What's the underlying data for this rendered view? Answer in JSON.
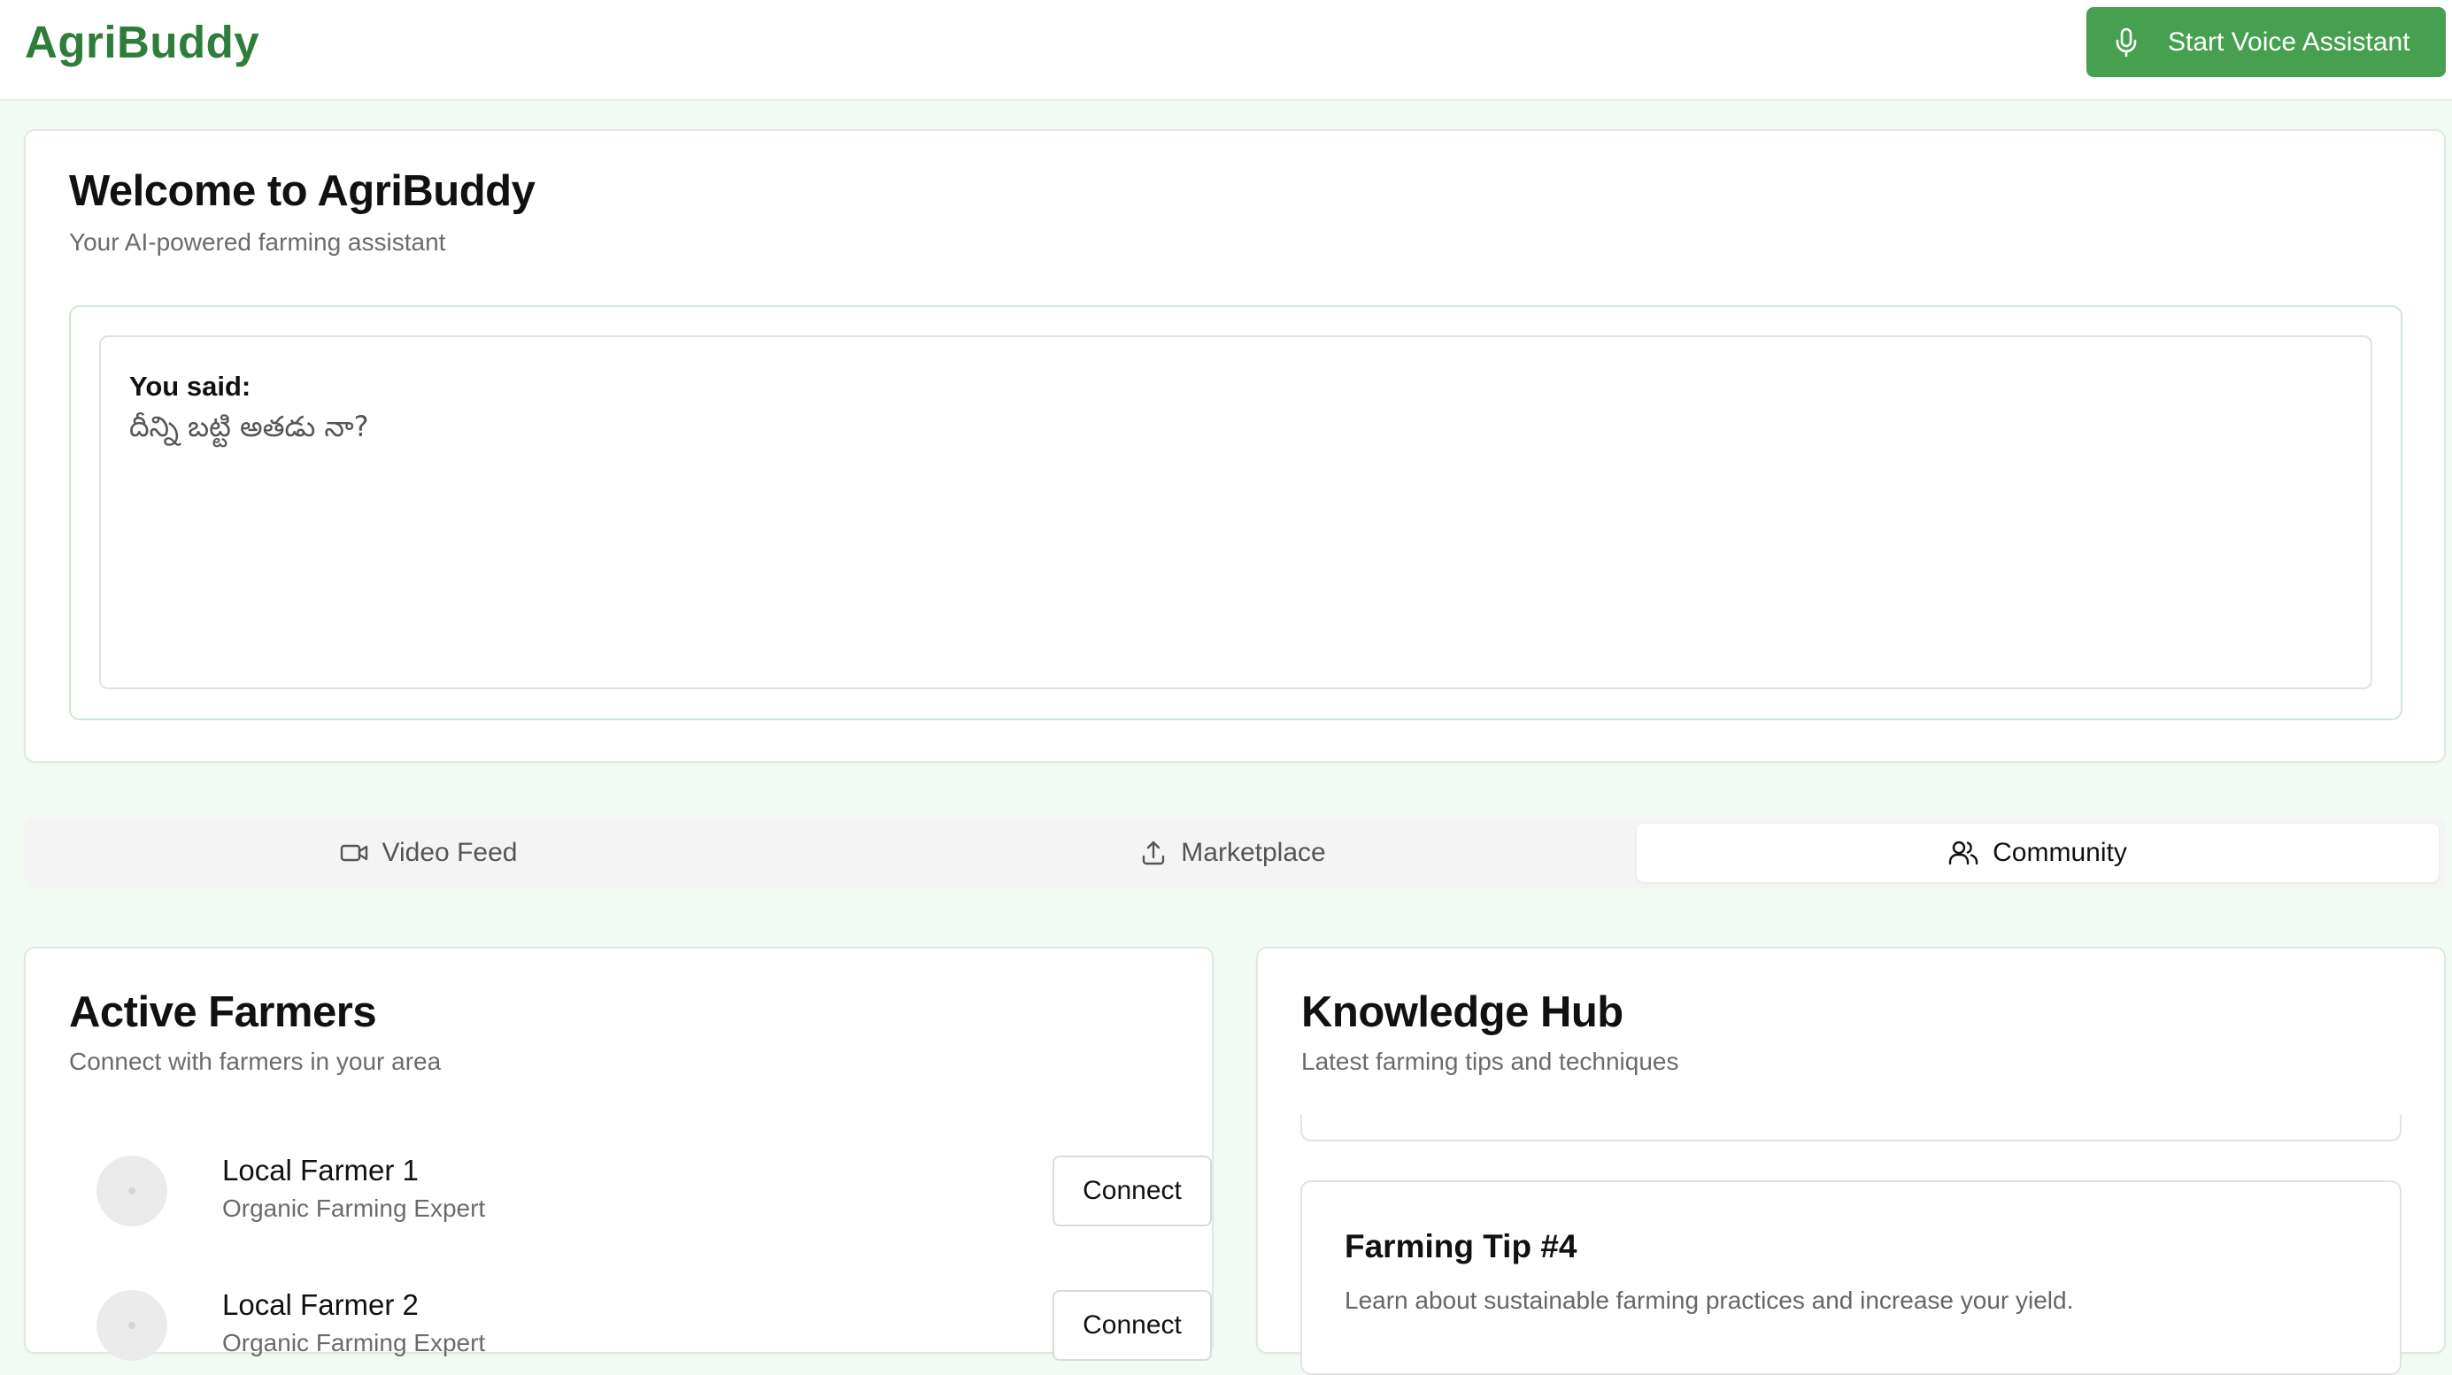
{
  "header": {
    "logo": "AgriBuddy",
    "voice_button": "Start Voice Assistant"
  },
  "welcome": {
    "title": "Welcome to AgriBuddy",
    "subtitle": "Your AI-powered farming assistant",
    "you_said_label": "You said:",
    "you_said_text": "దీన్ని బట్టి అతడు నా?"
  },
  "tabs": [
    {
      "label": "Video Feed",
      "icon": "video-icon",
      "active": false
    },
    {
      "label": "Marketplace",
      "icon": "upload-icon",
      "active": false
    },
    {
      "label": "Community",
      "icon": "users-icon",
      "active": true
    }
  ],
  "farmers": {
    "title": "Active Farmers",
    "subtitle": "Connect with farmers in your area",
    "items": [
      {
        "name": "Local Farmer 1",
        "role": "Organic Farming Expert",
        "button": "Connect"
      },
      {
        "name": "Local Farmer 2",
        "role": "Organic Farming Expert",
        "button": "Connect"
      }
    ]
  },
  "hub": {
    "title": "Knowledge Hub",
    "subtitle": "Latest farming tips and techniques",
    "tip": {
      "title": "Farming Tip #4",
      "text": "Learn about sustainable farming practices and increase your yield."
    }
  },
  "colors": {
    "brand": "#2f7d3a",
    "button": "#46a04f",
    "page_bg": "#f2fbf3"
  }
}
